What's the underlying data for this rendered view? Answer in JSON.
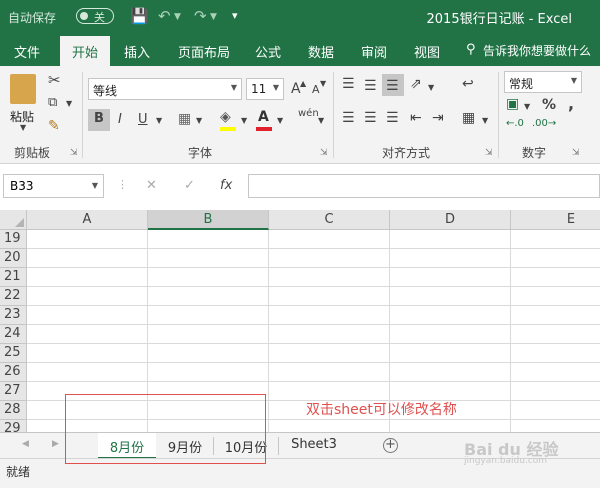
{
  "titlebar": {
    "autosave_label": "自动保存",
    "autosave_state": "关",
    "doc_title": "2015银行日记账  -  Excel"
  },
  "ribbon_tabs": [
    "文件",
    "开始",
    "插入",
    "页面布局",
    "公式",
    "数据",
    "审阅",
    "视图"
  ],
  "tell_me": "告诉我你想要做什么",
  "ribbon": {
    "clipboard": {
      "paste": "粘贴",
      "label": "剪贴板"
    },
    "font": {
      "name": "等线",
      "size": "11",
      "label": "字体",
      "grow": "A",
      "shrink": "A",
      "bold": "B",
      "italic": "I",
      "underline": "U",
      "phonetic": "wén"
    },
    "alignment": {
      "label": "对齐方式"
    },
    "number": {
      "format": "常规",
      "label": "数字",
      "percent": "%",
      "comma": ","
    }
  },
  "formula_bar": {
    "name_box": "B33",
    "fx": "fx",
    "value": ""
  },
  "grid": {
    "columns": [
      "A",
      "B",
      "C",
      "D",
      "E"
    ],
    "selected_column": "B",
    "rows": [
      "19",
      "20",
      "21",
      "22",
      "23",
      "24",
      "25",
      "26",
      "27",
      "28",
      "29"
    ]
  },
  "sheets": [
    {
      "name": "8月份",
      "active": true
    },
    {
      "name": "9月份",
      "active": false
    },
    {
      "name": "10月份",
      "active": false
    },
    {
      "name": "Sheet3",
      "active": false
    }
  ],
  "status": "就绪",
  "annotation": "双击sheet可以修改名称",
  "watermark": {
    "main": "Bai du 经验",
    "sub": "jingyan.baidu.com"
  },
  "colors": {
    "accent": "#217346",
    "annotation": "#e0504f"
  }
}
